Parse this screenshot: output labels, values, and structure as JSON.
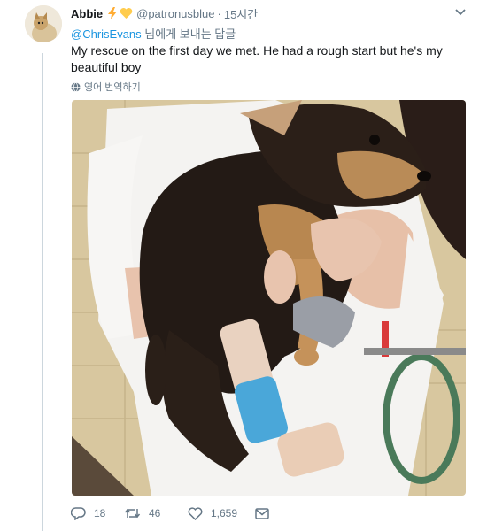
{
  "tweet": {
    "display_name": "Abbie",
    "handle": "@patronusblue",
    "separator": "·",
    "time": "15시간",
    "replying_mention": "@ChrisEvans",
    "replying_suffix": " 님에게 보내는 답글",
    "text": "My rescue on the first day we met. He had a rough start but he's my beautiful boy",
    "translate_label": "영어 번역하기",
    "badges": [
      "lightning-icon",
      "heart-icon"
    ],
    "image_subject": "puppy"
  },
  "actions": {
    "reply_count": "18",
    "retweet_count": "46",
    "like_count": "1,659"
  },
  "colors": {
    "link": "#1b95e0",
    "muted": "#657786",
    "thread_line": "#ccd6dd",
    "lightning": "#ffac33",
    "heart": "#ffcc4d"
  }
}
